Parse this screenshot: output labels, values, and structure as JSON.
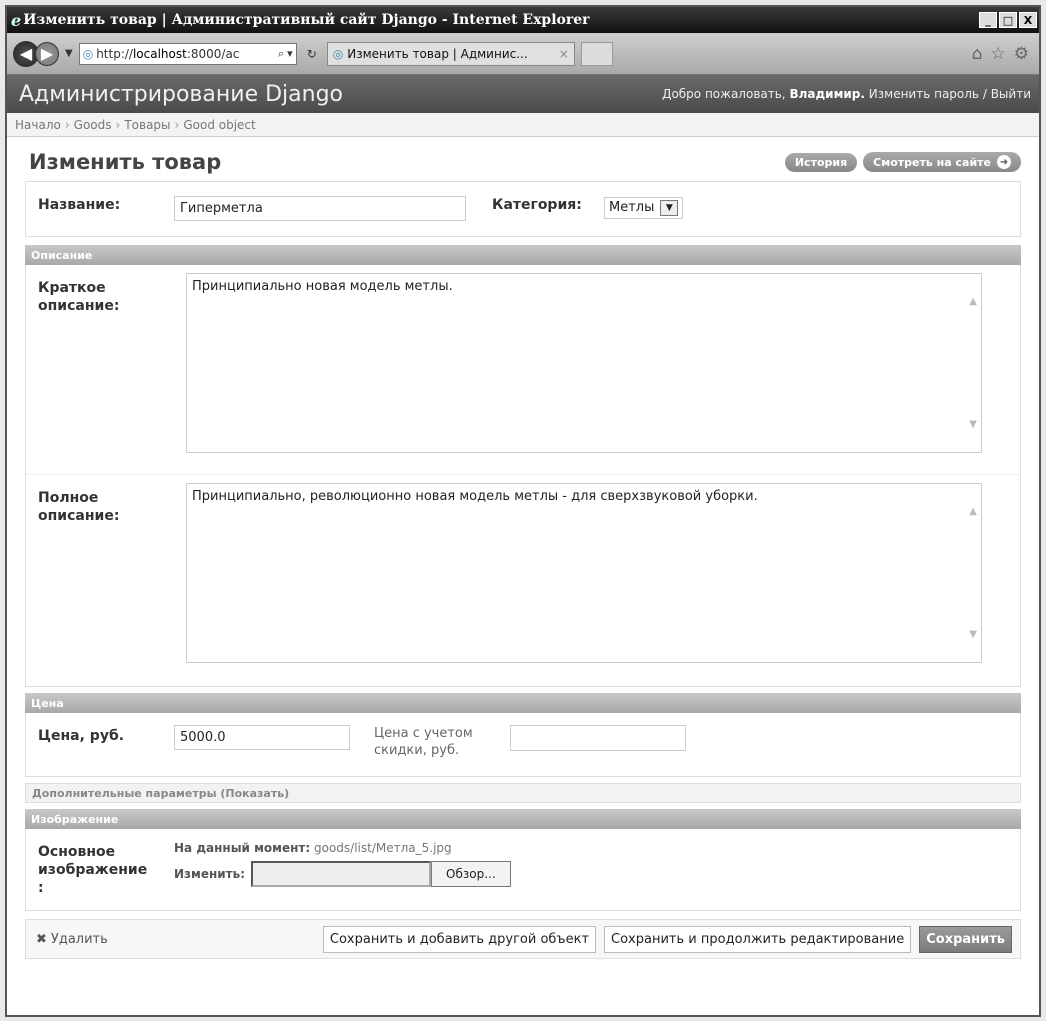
{
  "window": {
    "title": "Изменить товар | Административный сайт Django - Internet Explorer",
    "min": "_",
    "max": "□",
    "close": "X"
  },
  "browser": {
    "url_prefix": "http://",
    "url_host": "localhost",
    "url_rest": ":8000/ac",
    "search_icon": "⌕",
    "tab_title": "Изменить товар | Админис...",
    "tab_close": "×"
  },
  "admin": {
    "brand": "Администрирование Django",
    "welcome": "Добро пожаловать,",
    "user": "Владимир.",
    "change_password": "Изменить пароль",
    "sep": "/",
    "logout": "Выйти"
  },
  "breadcrumbs": [
    "Начало",
    "Goods",
    "Товары",
    "Good object"
  ],
  "page": {
    "title": "Изменить товар",
    "history": "История",
    "view_on_site": "Смотреть на сайте"
  },
  "form": {
    "name_label": "Название:",
    "name_value": "Гиперметла",
    "category_label": "Категория:",
    "category_value": "Метлы",
    "description_section": "Описание",
    "short_label_1": "Краткое",
    "short_label_2": "описание:",
    "short_value": "Принципиально новая модель метлы.",
    "full_label_1": "Полное",
    "full_label_2": "описание:",
    "full_value": "Принципиально, революционно новая модель метлы - для сверхзвуковой уборки.",
    "price_section": "Цена",
    "price_label": "Цена, руб.",
    "price_value": "5000.0",
    "discount_label_1": "Цена с учетом",
    "discount_label_2": "скидки, руб.",
    "discount_value": "",
    "extra_section": "Дополнительные параметры (Показать)",
    "image_section": "Изображение",
    "image_label_1": "Основное",
    "image_label_2": "изображение",
    "image_label_3": ":",
    "current_label": "На данный момент:",
    "current_value": "goods/list/Метла_5.jpg",
    "change_label": "Изменить:",
    "browse": "Обзор..."
  },
  "actions": {
    "delete": "Удалить",
    "save_add": "Сохранить и добавить другой объект",
    "save_continue": "Сохранить и продолжить редактирование",
    "save": "Сохранить"
  }
}
